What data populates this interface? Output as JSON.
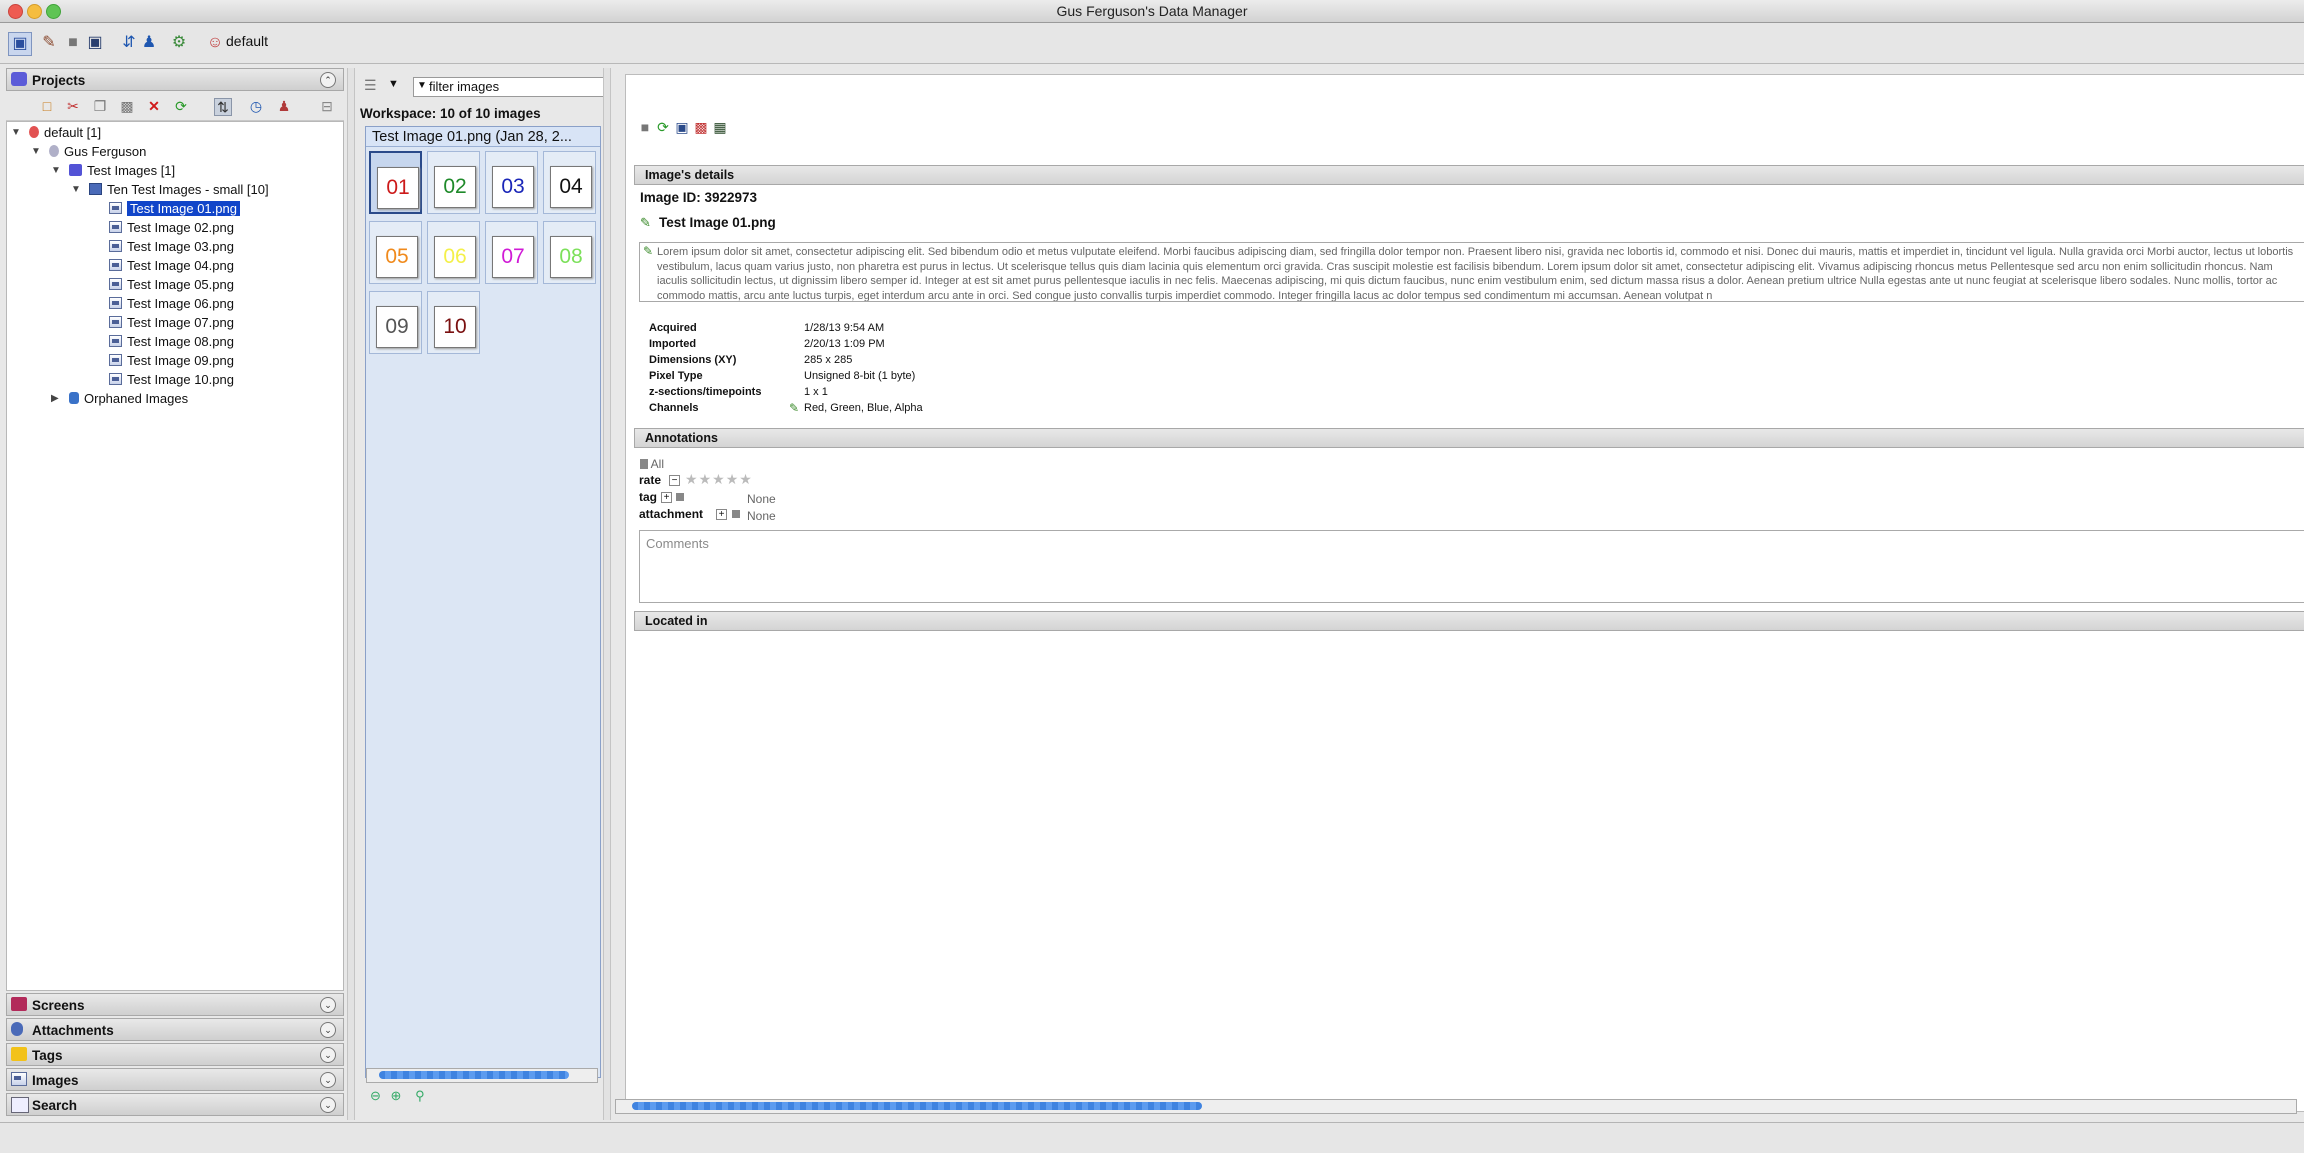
{
  "window": {
    "title": "Gus Ferguson's Data Manager"
  },
  "toolbar": {
    "group_label": "default"
  },
  "sidebar": {
    "projects_header": "Projects",
    "tree": {
      "root": "default [1]",
      "user": "Gus Ferguson",
      "project": "Test Images [1]",
      "dataset": "Ten Test Images - small [10]",
      "images": [
        "Test Image 01.png",
        "Test Image 02.png",
        "Test Image 03.png",
        "Test Image 04.png",
        "Test Image 05.png",
        "Test Image 06.png",
        "Test Image 07.png",
        "Test Image 08.png",
        "Test Image 09.png",
        "Test Image 10.png"
      ],
      "orphaned": "Orphaned Images"
    },
    "panels": [
      "Screens",
      "Attachments",
      "Tags",
      "Images",
      "Search"
    ]
  },
  "workspace": {
    "filter": "filter  images",
    "count_label": "Workspace: 10 of 10 images",
    "selected_header": "Test Image 01.png (Jan 28, 2...",
    "thumbs": [
      {
        "label": "01",
        "color": "#cc1a1a"
      },
      {
        "label": "02",
        "color": "#1f8a2a"
      },
      {
        "label": "03",
        "color": "#1a26b8"
      },
      {
        "label": "04",
        "color": "#111111"
      },
      {
        "label": "05",
        "color": "#f08a1c"
      },
      {
        "label": "06",
        "color": "#f4f04a"
      },
      {
        "label": "07",
        "color": "#d01ad6"
      },
      {
        "label": "08",
        "color": "#7ce05a"
      },
      {
        "label": "09",
        "color": "#555555"
      },
      {
        "label": "10",
        "color": "#7a1010"
      }
    ]
  },
  "details": {
    "section_title": "Image's details",
    "image_id": "Image ID: 3922973",
    "name": "Test Image 01.png",
    "description": "Lorem ipsum dolor sit amet, consectetur adipiscing elit. Sed bibendum odio et metus vulputate eleifend. Morbi faucibus adipiscing diam, sed fringilla dolor tempor non. Praesent libero nisi, gravida nec lobortis id, commodo et nisi. Donec dui mauris, mattis et imperdiet in, tincidunt vel ligula. Nulla gravida orci Morbi auctor, lectus ut lobortis vestibulum, lacus quam varius justo, non pharetra est purus in lectus. Ut scelerisque tellus quis diam lacinia quis elementum orci gravida. Cras suscipit molestie est facilisis bibendum. Lorem ipsum dolor sit amet, consectetur adipiscing elit. Vivamus adipiscing rhoncus metus Pellentesque sed arcu non enim sollicitudin rhoncus. Nam iaculis sollicitudin lectus, ut dignissim libero semper id. Integer at est sit amet purus pellentesque iaculis in nec felis. Maecenas adipiscing, mi quis dictum faucibus, nunc enim vestibulum enim, sed dictum massa risus a dolor. Aenean pretium ultrice Nulla egestas ante ut nunc feugiat at scelerisque libero sodales. Nunc mollis, tortor ac commodo mattis, arcu ante luctus turpis, eget interdum arcu ante in orci. Sed congue justo convallis turpis imperdiet commodo. Integer fringilla lacus ac dolor tempus sed condimentum mi accumsan. Aenean volutpat n",
    "meta": [
      {
        "label": "Acquired",
        "value": "1/28/13 9:54 AM"
      },
      {
        "label": "Imported",
        "value": "2/20/13 1:09 PM"
      },
      {
        "label": "Dimensions (XY)",
        "value": "285 x 285"
      },
      {
        "label": "Pixel Type",
        "value": "Unsigned 8-bit (1 byte)"
      },
      {
        "label": "z-sections/timepoints",
        "value": "1 x 1"
      },
      {
        "label": "Channels",
        "value": "Red, Green, Blue, Alpha"
      }
    ],
    "annotations_title": "Annotations",
    "annotations": {
      "all": "All",
      "rate_label": "rate",
      "rating": 0,
      "tag_label": "tag",
      "tag_value": "None",
      "attachment_label": "attachment",
      "attachment_value": "None"
    },
    "comments_placeholder": "Comments",
    "located_title": "Located in"
  }
}
